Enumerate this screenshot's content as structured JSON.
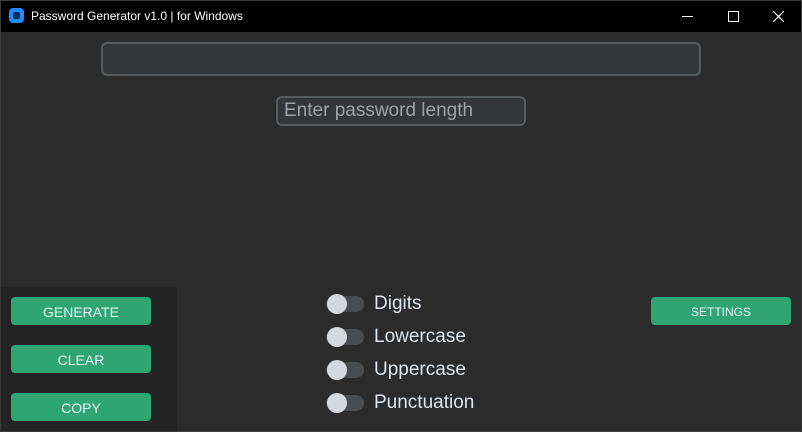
{
  "window": {
    "title": "Password Generator v1.0 | for Windows"
  },
  "main": {
    "output_value": "",
    "length_placeholder": "Enter password length",
    "length_value": ""
  },
  "actions": {
    "generate_label": "GENERATE",
    "clear_label": "CLEAR",
    "copy_label": "COPY",
    "settings_label": "SETTINGS"
  },
  "options": [
    {
      "label": "Digits",
      "enabled": false
    },
    {
      "label": "Lowercase",
      "enabled": false
    },
    {
      "label": "Uppercase",
      "enabled": false
    },
    {
      "label": "Punctuation",
      "enabled": false
    }
  ],
  "colors": {
    "accent": "#2fa572",
    "panel": "#2b2b2b",
    "titlebar": "#000000",
    "app_icon": "#1a8cff"
  }
}
